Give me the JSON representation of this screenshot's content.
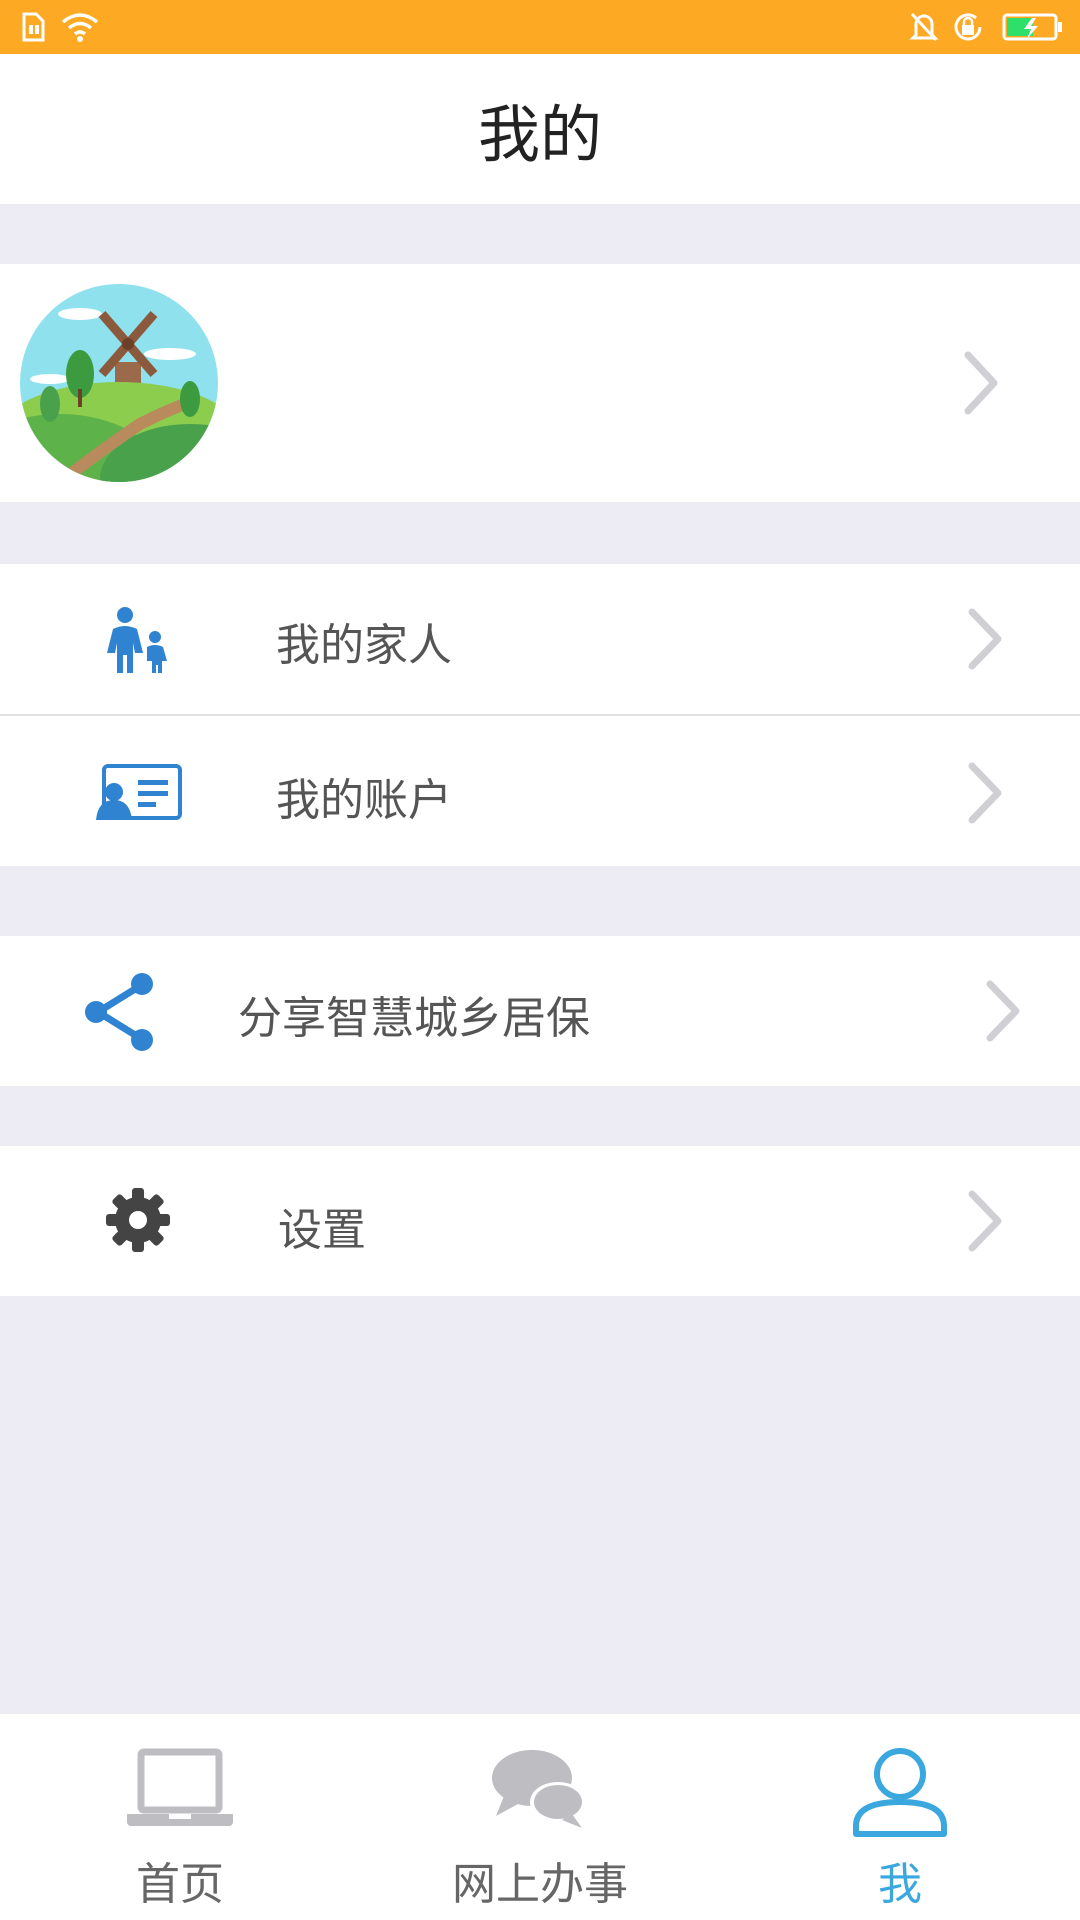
{
  "header": {
    "title": "我的"
  },
  "profile": {
    "avatar": "avatar-landscape-windmill"
  },
  "menu": {
    "family": {
      "label": "我的家人",
      "icon": "family-icon"
    },
    "account": {
      "label": "我的账户",
      "icon": "id-card-icon"
    },
    "share": {
      "label": "分享智慧城乡居保",
      "icon": "share-icon"
    },
    "settings": {
      "label": "设置",
      "icon": "gear-icon"
    }
  },
  "tabs": [
    {
      "label": "首页",
      "icon": "laptop-icon",
      "active": false
    },
    {
      "label": "网上办事",
      "icon": "chat-bubbles-icon",
      "active": false
    },
    {
      "label": "我",
      "icon": "person-icon",
      "active": true
    }
  ],
  "colors": {
    "status_bar": "#fda924",
    "accent": "#3aa7df",
    "icon_blue": "#2f83d0",
    "background": "#edebf3"
  }
}
